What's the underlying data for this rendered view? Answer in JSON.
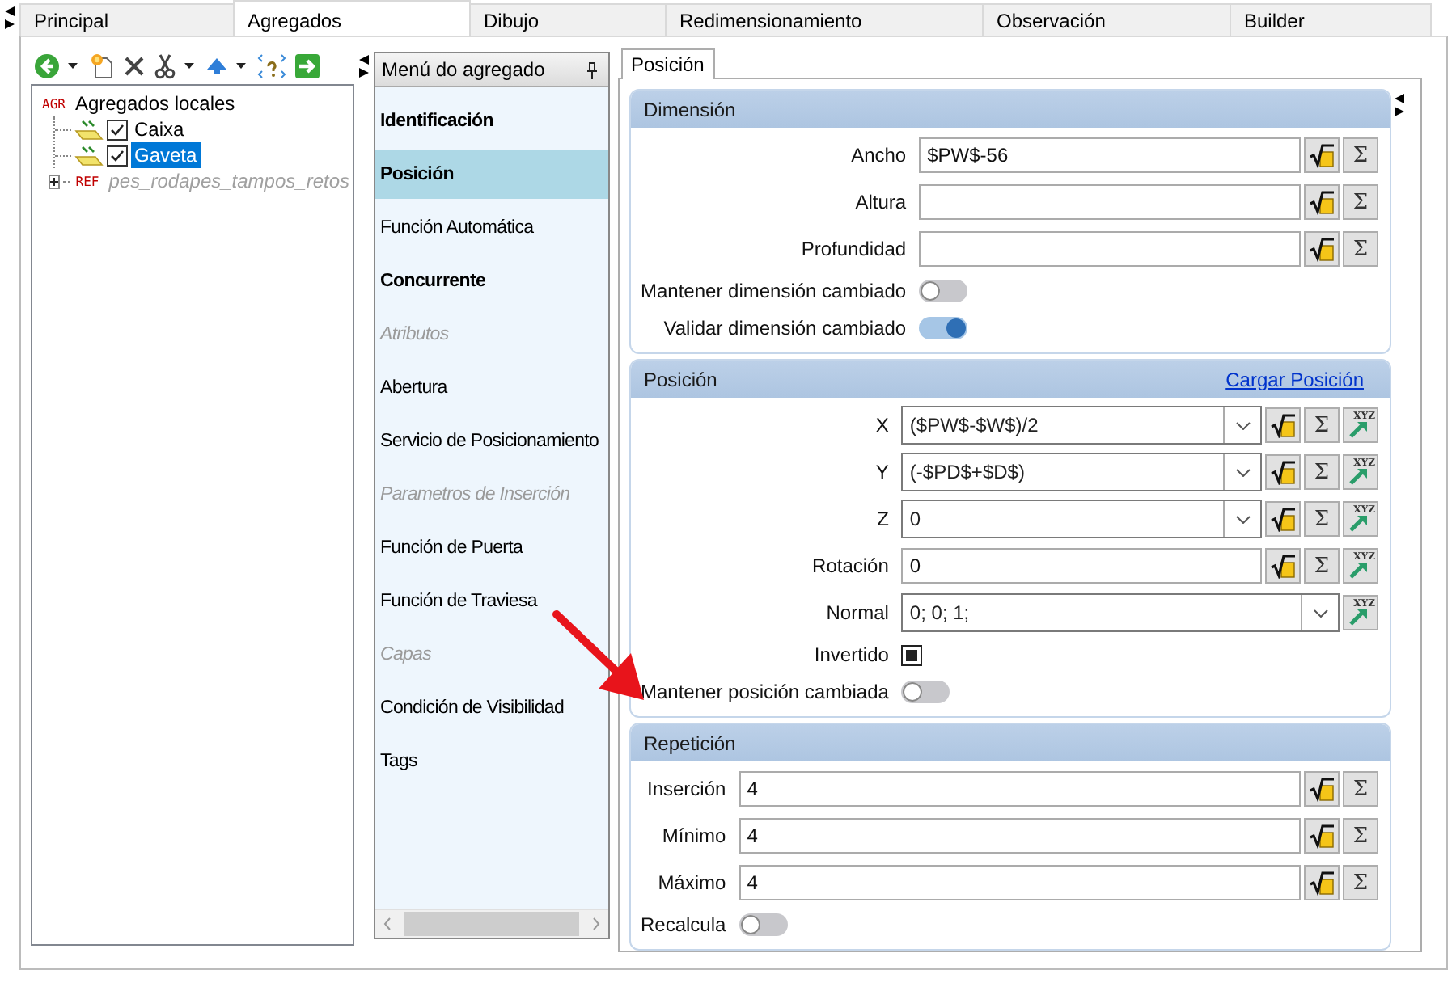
{
  "tabs": [
    {
      "label": "Principal",
      "selected": false
    },
    {
      "label": "Agregados",
      "selected": true
    },
    {
      "label": "Dibujo",
      "selected": false
    },
    {
      "label": "Redimensionamiento",
      "selected": false
    },
    {
      "label": "Observación",
      "selected": false
    },
    {
      "label": "Builder",
      "selected": false
    }
  ],
  "tree": [
    {
      "label": "Agregados locales",
      "tag": "AGR",
      "selected": false,
      "disabled": false,
      "children": [
        {
          "label": "Caixa",
          "checked": true,
          "selected": false
        },
        {
          "label": "Gaveta",
          "checked": true,
          "selected": true
        }
      ]
    },
    {
      "label": "pes_rodapes_tampos_retos",
      "tag": "REF",
      "selected": false,
      "disabled": true,
      "expanded": false
    }
  ],
  "menu": {
    "title": "Menú do agregado",
    "items": [
      {
        "label": "Identificación",
        "bold": true,
        "disabled": false,
        "selected": false
      },
      {
        "label": "Posición",
        "bold": true,
        "disabled": false,
        "selected": true
      },
      {
        "label": "Función Automática",
        "bold": false,
        "disabled": false,
        "selected": false
      },
      {
        "label": "Concurrente",
        "bold": true,
        "disabled": false,
        "selected": false
      },
      {
        "label": "Atributos",
        "bold": false,
        "disabled": true,
        "selected": false
      },
      {
        "label": "Abertura",
        "bold": false,
        "disabled": false,
        "selected": false
      },
      {
        "label": "Servicio de Posicionamiento",
        "bold": false,
        "disabled": false,
        "selected": false
      },
      {
        "label": "Parametros de Inserción",
        "bold": false,
        "disabled": true,
        "selected": false
      },
      {
        "label": "Función de Puerta",
        "bold": false,
        "disabled": false,
        "selected": false
      },
      {
        "label": "Función de Traviesa",
        "bold": false,
        "disabled": false,
        "selected": false
      },
      {
        "label": "Capas",
        "bold": false,
        "disabled": true,
        "selected": false
      },
      {
        "label": "Condición de Visibilidad",
        "bold": false,
        "disabled": false,
        "selected": false
      },
      {
        "label": "Tags",
        "bold": false,
        "disabled": false,
        "selected": false
      }
    ]
  },
  "detail": {
    "tab": {
      "label": "Posición",
      "selected": true
    },
    "groups": [
      {
        "title": "Dimensión",
        "rows": [
          {
            "kind": "text",
            "label": "Ancho",
            "value": "$PW$-56",
            "tools": [
              {
                "kind": "formula"
              },
              {
                "kind": "sum",
                "label": "Σ"
              }
            ]
          },
          {
            "kind": "text",
            "label": "Altura",
            "tools": [
              {
                "kind": "formula"
              },
              {
                "kind": "sum",
                "label": "Σ"
              }
            ]
          },
          {
            "kind": "text",
            "label": "Profundidad",
            "tools": [
              {
                "kind": "formula"
              },
              {
                "kind": "sum",
                "label": "Σ"
              }
            ]
          },
          {
            "kind": "toggle",
            "label": "Mantener dimensión cambiado",
            "on": false
          },
          {
            "kind": "toggle",
            "label": "Validar dimensión cambiado",
            "on": true
          }
        ]
      },
      {
        "title": "Posición",
        "link": "Cargar Posición",
        "rows": [
          {
            "kind": "combo",
            "label": "X",
            "value": "($PW$-$W$)/2",
            "tools": [
              {
                "kind": "formula"
              },
              {
                "kind": "sum",
                "label": "Σ"
              },
              {
                "kind": "pick",
                "label": "XYZ"
              }
            ]
          },
          {
            "kind": "combo",
            "label": "Y",
            "value": "(-$PD$+$D$)",
            "tools": [
              {
                "kind": "formula"
              },
              {
                "kind": "sum",
                "label": "Σ"
              },
              {
                "kind": "pick",
                "label": "XYZ"
              }
            ]
          },
          {
            "kind": "combo",
            "label": "Z",
            "value": "0",
            "tools": [
              {
                "kind": "formula"
              },
              {
                "kind": "sum",
                "label": "Σ"
              },
              {
                "kind": "pick",
                "label": "XYZ"
              }
            ]
          },
          {
            "kind": "text",
            "label": "Rotación",
            "value": "0",
            "tools": [
              {
                "kind": "formula"
              },
              {
                "kind": "sum",
                "label": "Σ"
              },
              {
                "kind": "pick",
                "label": "XYZ"
              }
            ]
          },
          {
            "kind": "combo",
            "label": "Normal",
            "value": "0; 0; 1;",
            "tools": [
              {
                "kind": "pick",
                "label": "XYZ"
              }
            ]
          },
          {
            "kind": "checkbox",
            "label": "Invertido",
            "checked": true
          },
          {
            "kind": "toggle",
            "label": "Mantener posición cambiada",
            "on": false
          }
        ]
      },
      {
        "title": "Repetición",
        "rows": [
          {
            "kind": "text",
            "label": "Inserción",
            "value": "4",
            "tools": [
              {
                "kind": "formula"
              },
              {
                "kind": "sum",
                "label": "Σ"
              }
            ]
          },
          {
            "kind": "text",
            "label": "Mínimo",
            "value": "4",
            "tools": [
              {
                "kind": "formula"
              },
              {
                "kind": "sum",
                "label": "Σ"
              }
            ]
          },
          {
            "kind": "text",
            "label": "Máximo",
            "value": "4",
            "tools": [
              {
                "kind": "formula"
              },
              {
                "kind": "sum",
                "label": "Σ"
              }
            ]
          },
          {
            "kind": "toggle",
            "label": "Recalcula",
            "on": false
          }
        ]
      }
    ]
  }
}
